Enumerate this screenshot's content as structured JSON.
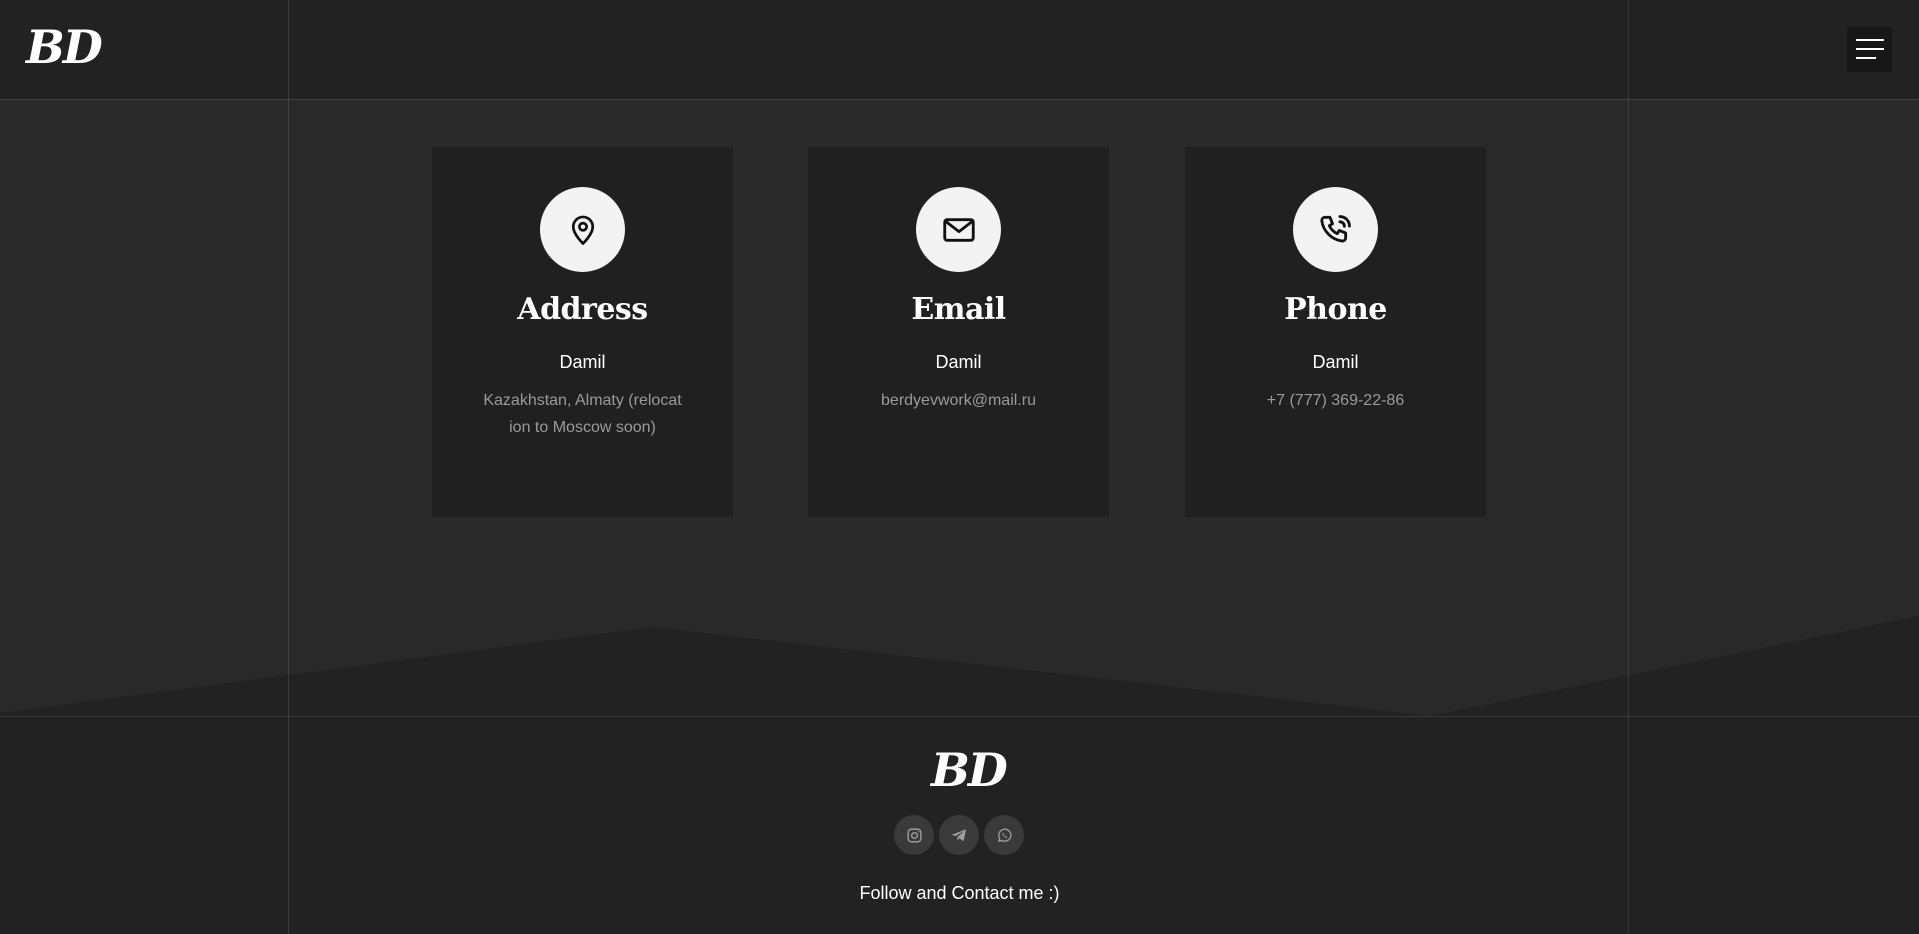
{
  "header": {
    "logo": "BD",
    "menu_icon": "hamburger-menu-icon"
  },
  "contacts": [
    {
      "title": "Address",
      "name": "Damil",
      "value": "Kazakhstan, Almaty (relocation to Moscow soon)",
      "icon": "location-pin-icon"
    },
    {
      "title": "Email",
      "name": "Damil",
      "value": "berdyevwork@mail.ru",
      "icon": "envelope-icon"
    },
    {
      "title": "Phone",
      "name": "Damil",
      "value": "+7 (777) 369-22-86",
      "icon": "phone-icon"
    }
  ],
  "footer": {
    "logo": "BD",
    "social": [
      {
        "icon": "instagram-icon"
      },
      {
        "icon": "telegram-icon"
      },
      {
        "icon": "whatsapp-icon"
      }
    ],
    "follow_text": "Follow and Contact me :)"
  },
  "colors": {
    "page_bg": "#292929",
    "header_bg": "#222222",
    "card_bg": "#202020",
    "icon_circle": "#f3f3f3",
    "muted_text": "#9a9a9a",
    "social_bg": "#3a3a3a"
  }
}
